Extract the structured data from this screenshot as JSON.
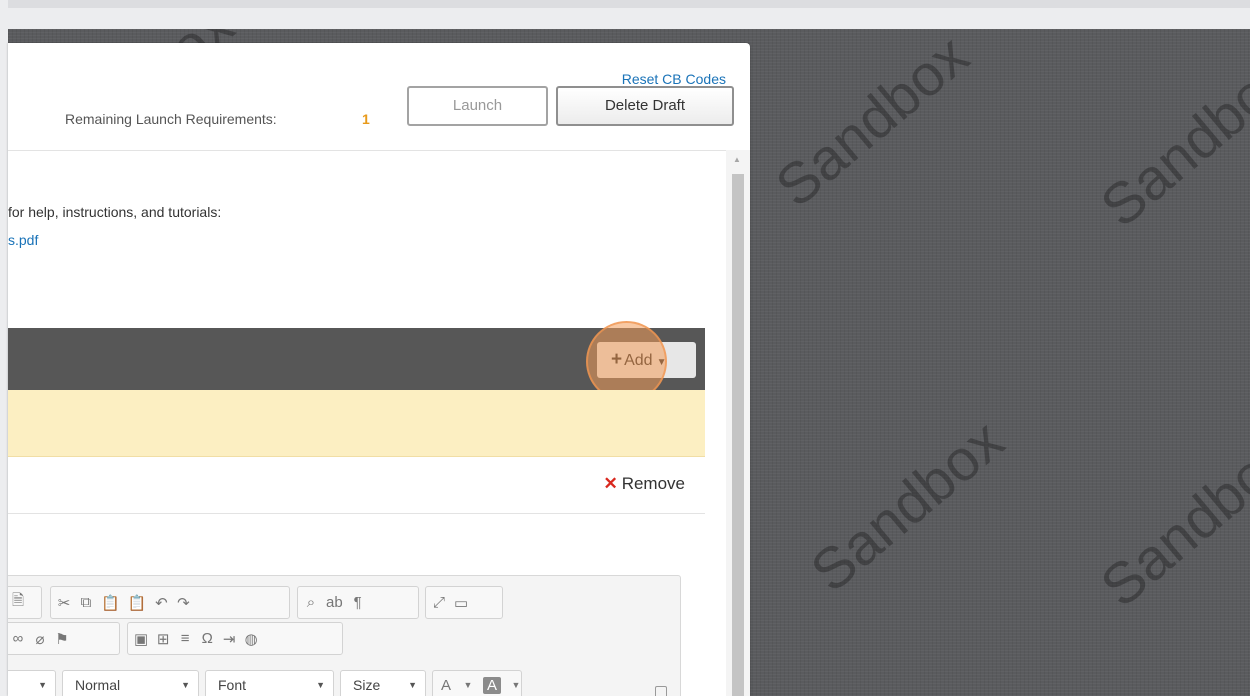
{
  "header": {
    "reset_link": "Reset CB Codes",
    "requirements_label": "Remaining Launch Requirements:",
    "requirements_count": "1",
    "launch_button": "Launch",
    "delete_button": "Delete Draft"
  },
  "content": {
    "help_text": "for help, instructions, and tutorials:",
    "help_link": "s.pdf",
    "add_button": "Add",
    "remove_button": "Remove"
  },
  "editor": {
    "format_select": "Normal",
    "font_select": "Font",
    "size_select": "Size",
    "text_color": "A",
    "bg_color": "A"
  },
  "watermark": "Sandbox",
  "colors": {
    "accent": "#1a73b8",
    "count": "#e89a1a",
    "highlight": "#f39c5a",
    "dark_bar": "#575757",
    "yellow_bar": "#fcefc2",
    "remove_x": "#d9281e"
  }
}
